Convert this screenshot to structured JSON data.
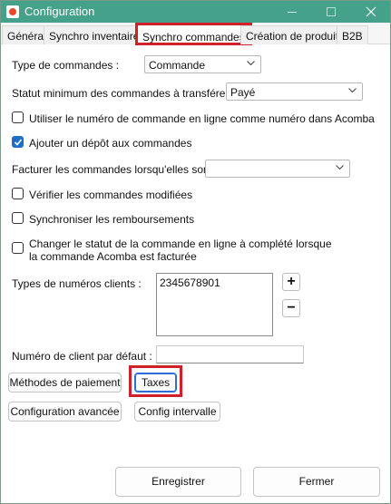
{
  "window": {
    "title": "Configuration",
    "close_symbol": "✕"
  },
  "tabs": [
    {
      "label": "Général"
    },
    {
      "label": "Synchro inventaires"
    },
    {
      "label": "Synchro commandes"
    },
    {
      "label": "Création de produits"
    },
    {
      "label": "B2B"
    }
  ],
  "form": {
    "order_type": {
      "label": "Type de commandes :",
      "value": "Commande"
    },
    "min_status": {
      "label": "Statut minimum des commandes à transférer :",
      "value": "Payé"
    },
    "use_online_number": {
      "label": "Utiliser le numéro de commande en ligne comme numéro dans Acomba",
      "checked": false
    },
    "add_deposit": {
      "label": "Ajouter un dépôt aux commandes",
      "checked": true
    },
    "invoice_when": {
      "label": "Facturer les commandes lorsqu'elles sont :",
      "value": ""
    },
    "verify_modified": {
      "label": "Vérifier les commandes modifiées",
      "checked": false
    },
    "sync_refunds": {
      "label": "Synchroniser les remboursements",
      "checked": false
    },
    "change_status": {
      "label_line1": "Changer le statut de la commande en ligne à complété lorsque",
      "label_line2": "la commande Acomba est facturée",
      "checked": false
    },
    "client_number_types": {
      "label": "Types de numéros clients :",
      "items": [
        "2345678901"
      ],
      "add_label": "+",
      "remove_label": "−"
    },
    "default_client": {
      "label": "Numéro de client par défaut :",
      "value": ""
    }
  },
  "buttons": {
    "payment_methods": "Méthodes de paiement",
    "taxes": "Taxes",
    "advanced_config": "Configuration avancée",
    "interval_config": "Config intervalle",
    "save": "Enregistrer",
    "close": "Fermer"
  },
  "colors": {
    "titlebar": "#45a18a",
    "highlight": "#d0202a",
    "checkbox_checked": "#1f6fc8"
  }
}
